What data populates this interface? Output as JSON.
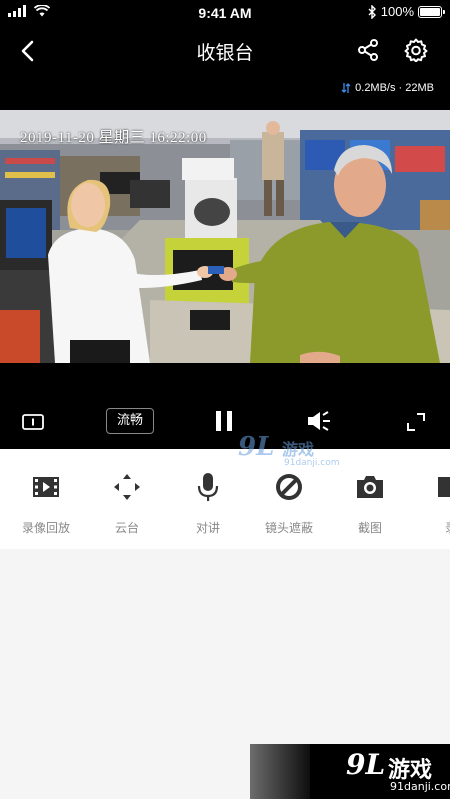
{
  "status_bar": {
    "time": "9:41 AM",
    "battery_text": "100%",
    "battery_level": 1.0
  },
  "header": {
    "title": "收银台",
    "back_icon": "chevron-left-icon",
    "share_icon": "share-icon",
    "settings_icon": "gear-icon"
  },
  "video": {
    "speed": "0.2MB/s · 22MB",
    "osd_timestamp": "2019-11-20 星期三 16:22:00",
    "quality_label": "流畅"
  },
  "toolbar": {
    "items": [
      {
        "label": "录像回放",
        "icon": "film-icon"
      },
      {
        "label": "云台",
        "icon": "ptz-arrows-icon"
      },
      {
        "label": "对讲",
        "icon": "microphone-icon"
      },
      {
        "label": "镜头遮蔽",
        "icon": "lens-block-icon"
      },
      {
        "label": "截图",
        "icon": "camera-icon"
      },
      {
        "label": "录",
        "icon": "record-icon"
      }
    ]
  },
  "watermark": {
    "logo_text": "9L",
    "name": "游戏",
    "url": "91danji.com"
  },
  "colors": {
    "bar_bg": "#000000",
    "page_bg": "#f5f5f5",
    "label_gray": "#888888",
    "icon_dark": "#333333"
  }
}
